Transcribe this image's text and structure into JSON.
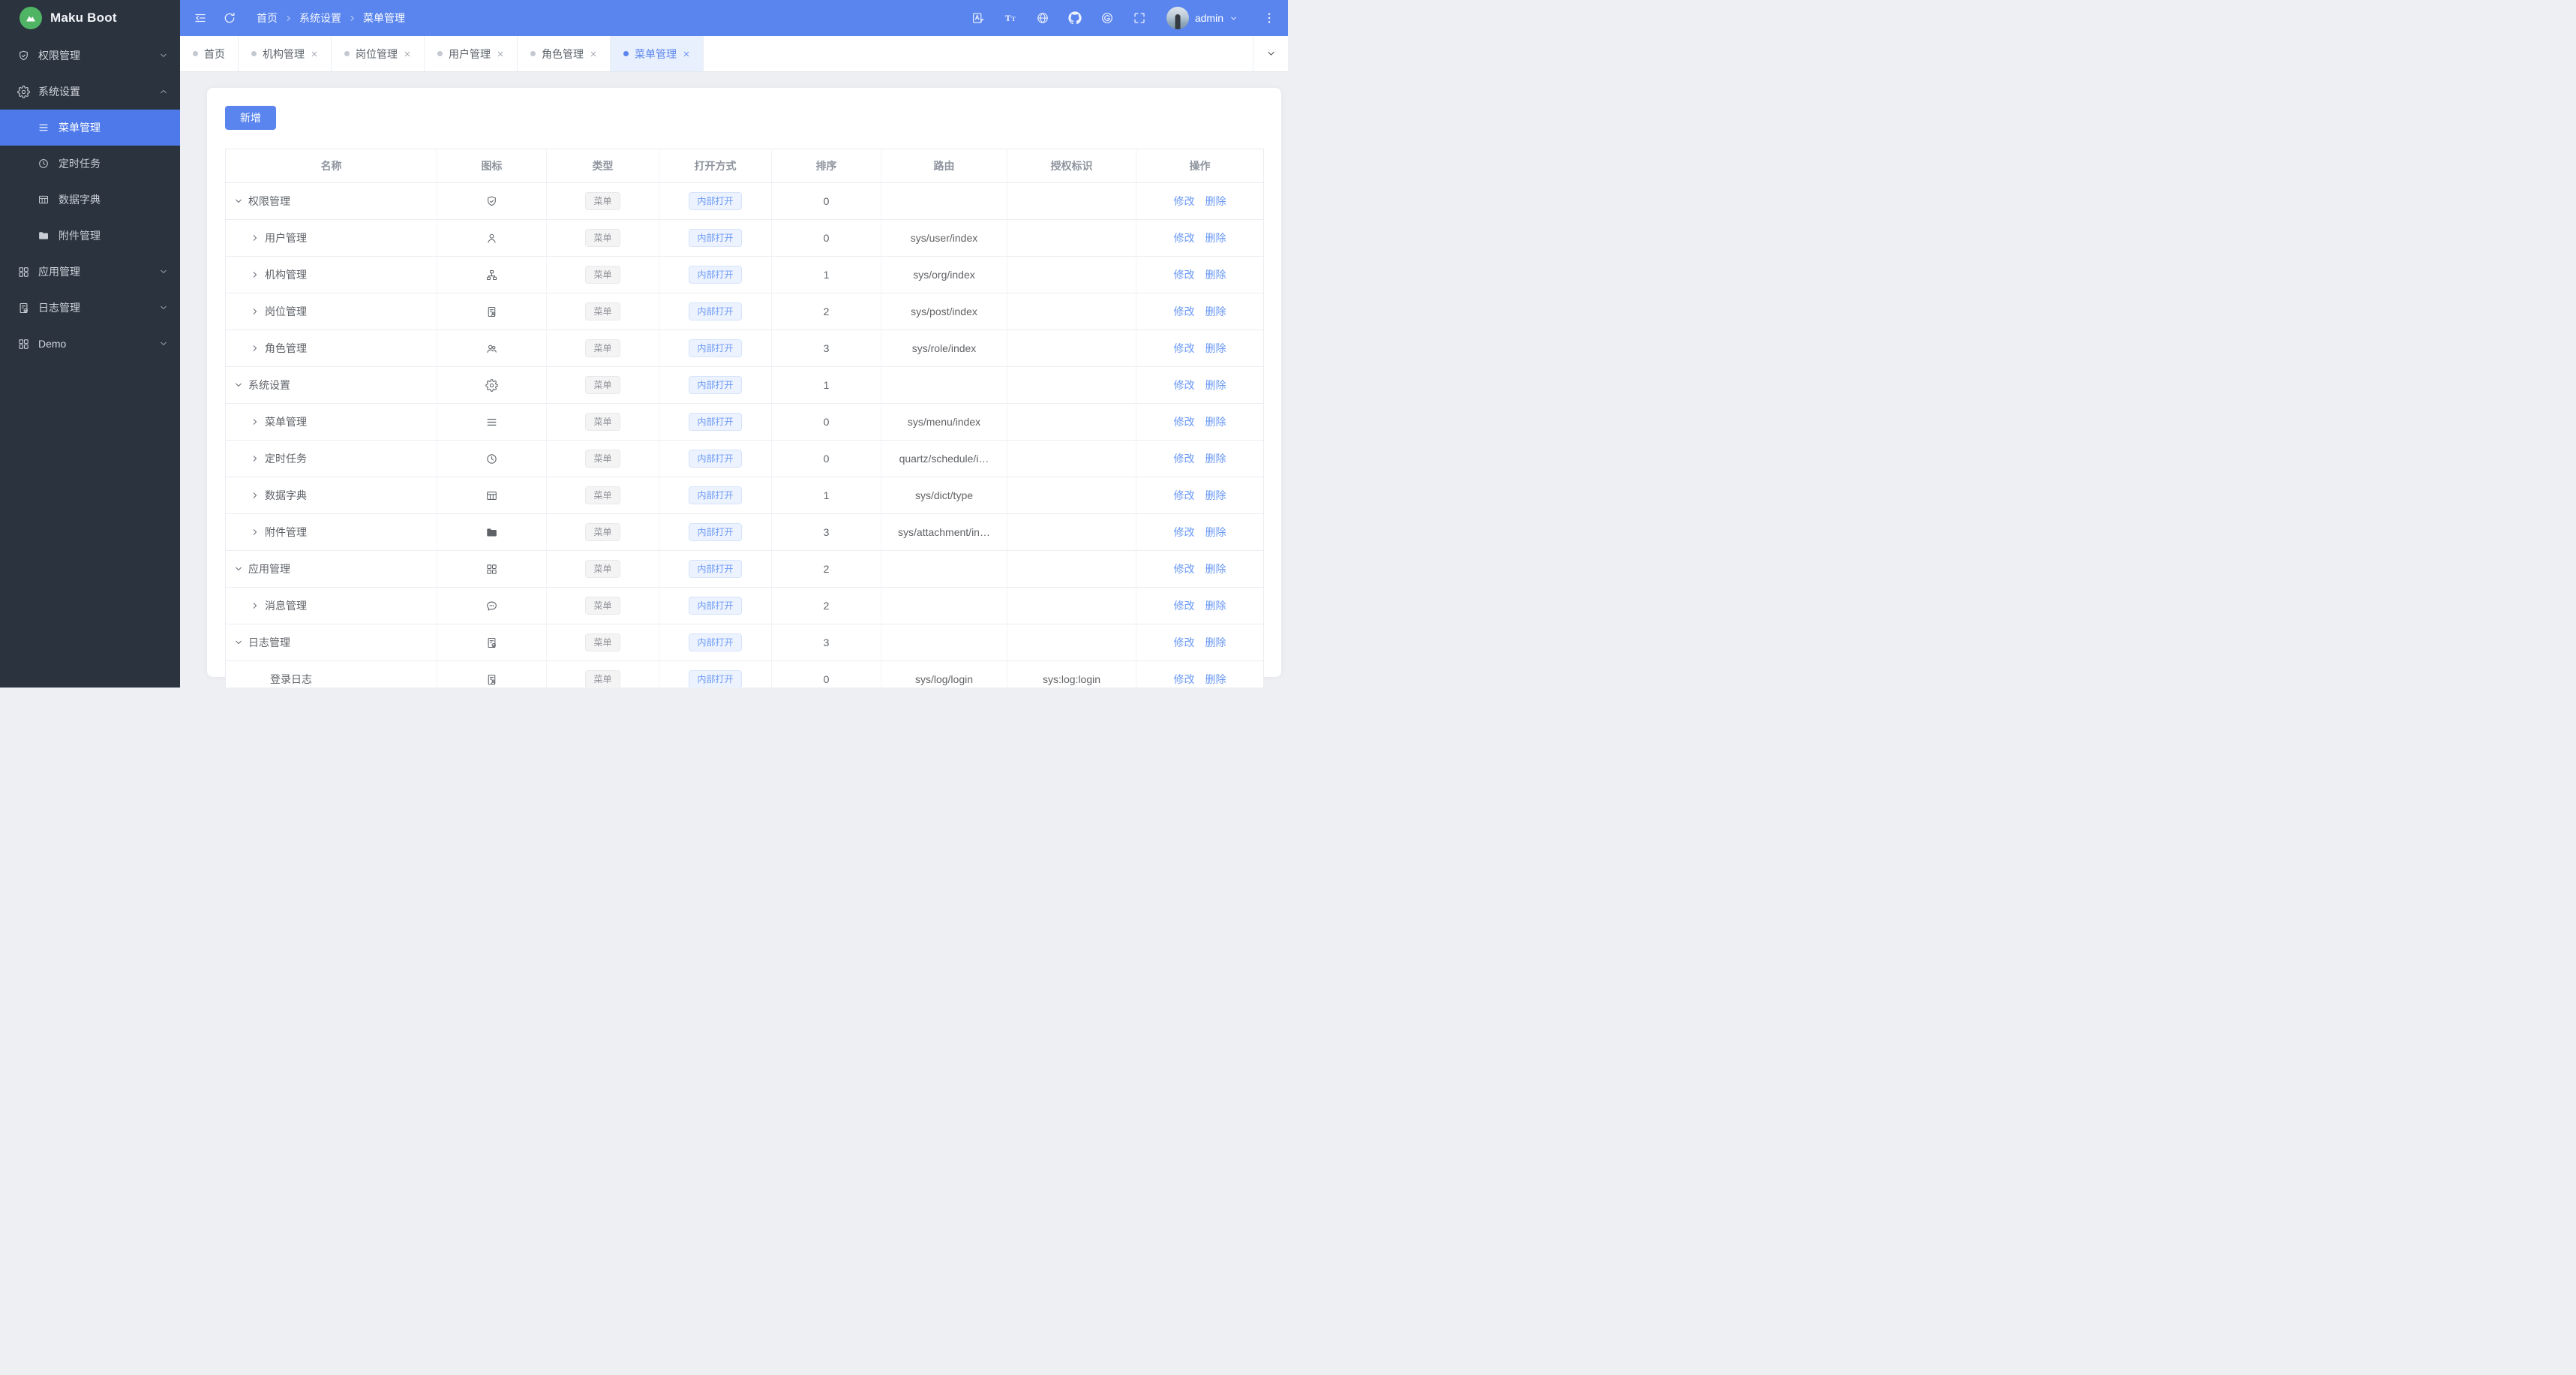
{
  "app": {
    "name": "Maku Boot"
  },
  "header": {
    "breadcrumb": [
      "首页",
      "系统设置",
      "菜单管理"
    ],
    "username": "admin",
    "action_icons": [
      "menu-collapse",
      "refresh",
      "translate",
      "font-size",
      "globe",
      "github",
      "gitee",
      "fullscreen",
      "more-dots"
    ]
  },
  "tabs": [
    {
      "label": "首页",
      "closable": false,
      "active": false
    },
    {
      "label": "机构管理",
      "closable": true,
      "active": false
    },
    {
      "label": "岗位管理",
      "closable": true,
      "active": false
    },
    {
      "label": "用户管理",
      "closable": true,
      "active": false
    },
    {
      "label": "角色管理",
      "closable": true,
      "active": false
    },
    {
      "label": "菜单管理",
      "closable": true,
      "active": true
    }
  ],
  "sidebar": {
    "items": [
      {
        "key": "permission",
        "label": "权限管理",
        "icon": "shield-check",
        "chevron": "down",
        "children": []
      },
      {
        "key": "system",
        "label": "系统设置",
        "icon": "gear",
        "chevron": "up",
        "expanded": true,
        "children": [
          {
            "key": "menu",
            "label": "菜单管理",
            "icon": "menu-lines",
            "active": true
          },
          {
            "key": "schedule",
            "label": "定时任务",
            "icon": "clock",
            "active": false
          },
          {
            "key": "dict",
            "label": "数据字典",
            "icon": "table-grid",
            "active": false
          },
          {
            "key": "attachment",
            "label": "附件管理",
            "icon": "folder-filled",
            "active": false
          }
        ]
      },
      {
        "key": "app",
        "label": "应用管理",
        "icon": "grid",
        "chevron": "down",
        "children": []
      },
      {
        "key": "log",
        "label": "日志管理",
        "icon": "doc-check",
        "chevron": "down",
        "children": []
      },
      {
        "key": "demo",
        "label": "Demo",
        "icon": "grid",
        "chevron": "down",
        "children": []
      }
    ]
  },
  "toolbar": {
    "add_label": "新增"
  },
  "table": {
    "columns": [
      "名称",
      "图标",
      "类型",
      "打开方式",
      "排序",
      "路由",
      "授权标识",
      "操作"
    ],
    "actions": [
      "修改",
      "删除"
    ],
    "rows": [
      {
        "name": "权限管理",
        "level": 0,
        "arrow": "down",
        "icon": "shield-check",
        "type": "菜单",
        "open": "内部打开",
        "sort": "0",
        "route": "",
        "auth": ""
      },
      {
        "name": "用户管理",
        "level": 1,
        "arrow": "right",
        "icon": "user",
        "type": "菜单",
        "open": "内部打开",
        "sort": "0",
        "route": "sys/user/index",
        "auth": ""
      },
      {
        "name": "机构管理",
        "level": 1,
        "arrow": "right",
        "icon": "org-tree",
        "type": "菜单",
        "open": "内部打开",
        "sort": "1",
        "route": "sys/org/index",
        "auth": ""
      },
      {
        "name": "岗位管理",
        "level": 1,
        "arrow": "right",
        "icon": "doc-person",
        "type": "菜单",
        "open": "内部打开",
        "sort": "2",
        "route": "sys/post/index",
        "auth": ""
      },
      {
        "name": "角色管理",
        "level": 1,
        "arrow": "right",
        "icon": "users",
        "type": "菜单",
        "open": "内部打开",
        "sort": "3",
        "route": "sys/role/index",
        "auth": ""
      },
      {
        "name": "系统设置",
        "level": 0,
        "arrow": "down",
        "icon": "gear",
        "type": "菜单",
        "open": "内部打开",
        "sort": "1",
        "route": "",
        "auth": ""
      },
      {
        "name": "菜单管理",
        "level": 1,
        "arrow": "right",
        "icon": "menu-lines",
        "type": "菜单",
        "open": "内部打开",
        "sort": "0",
        "route": "sys/menu/index",
        "auth": ""
      },
      {
        "name": "定时任务",
        "level": 1,
        "arrow": "right",
        "icon": "clock",
        "type": "菜单",
        "open": "内部打开",
        "sort": "0",
        "route": "quartz/schedule/i…",
        "auth": ""
      },
      {
        "name": "数据字典",
        "level": 1,
        "arrow": "right",
        "icon": "table-grid",
        "type": "菜单",
        "open": "内部打开",
        "sort": "1",
        "route": "sys/dict/type",
        "auth": ""
      },
      {
        "name": "附件管理",
        "level": 1,
        "arrow": "right",
        "icon": "folder-filled",
        "type": "菜单",
        "open": "内部打开",
        "sort": "3",
        "route": "sys/attachment/in…",
        "auth": ""
      },
      {
        "name": "应用管理",
        "level": 0,
        "arrow": "down",
        "icon": "grid",
        "type": "菜单",
        "open": "内部打开",
        "sort": "2",
        "route": "",
        "auth": ""
      },
      {
        "name": "消息管理",
        "level": 1,
        "arrow": "right",
        "icon": "chat",
        "type": "菜单",
        "open": "内部打开",
        "sort": "2",
        "route": "",
        "auth": ""
      },
      {
        "name": "日志管理",
        "level": 0,
        "arrow": "down",
        "icon": "doc-check",
        "type": "菜单",
        "open": "内部打开",
        "sort": "3",
        "route": "",
        "auth": ""
      },
      {
        "name": "登录日志",
        "level": 2,
        "arrow": "none",
        "icon": "doc-person",
        "type": "菜单",
        "open": "内部打开",
        "sort": "0",
        "route": "sys/log/login",
        "auth": "sys:log:login"
      }
    ]
  },
  "colors": {
    "primary": "#5a85ee",
    "sidebar_bg": "#2a333e",
    "sidebar_active": "#4d79ea",
    "link": "#6897f6",
    "logo_green": "#50b465",
    "tag_gray_text": "#909399",
    "tag_blue_text": "#6d9bf5",
    "page_bg": "#edeff3"
  }
}
